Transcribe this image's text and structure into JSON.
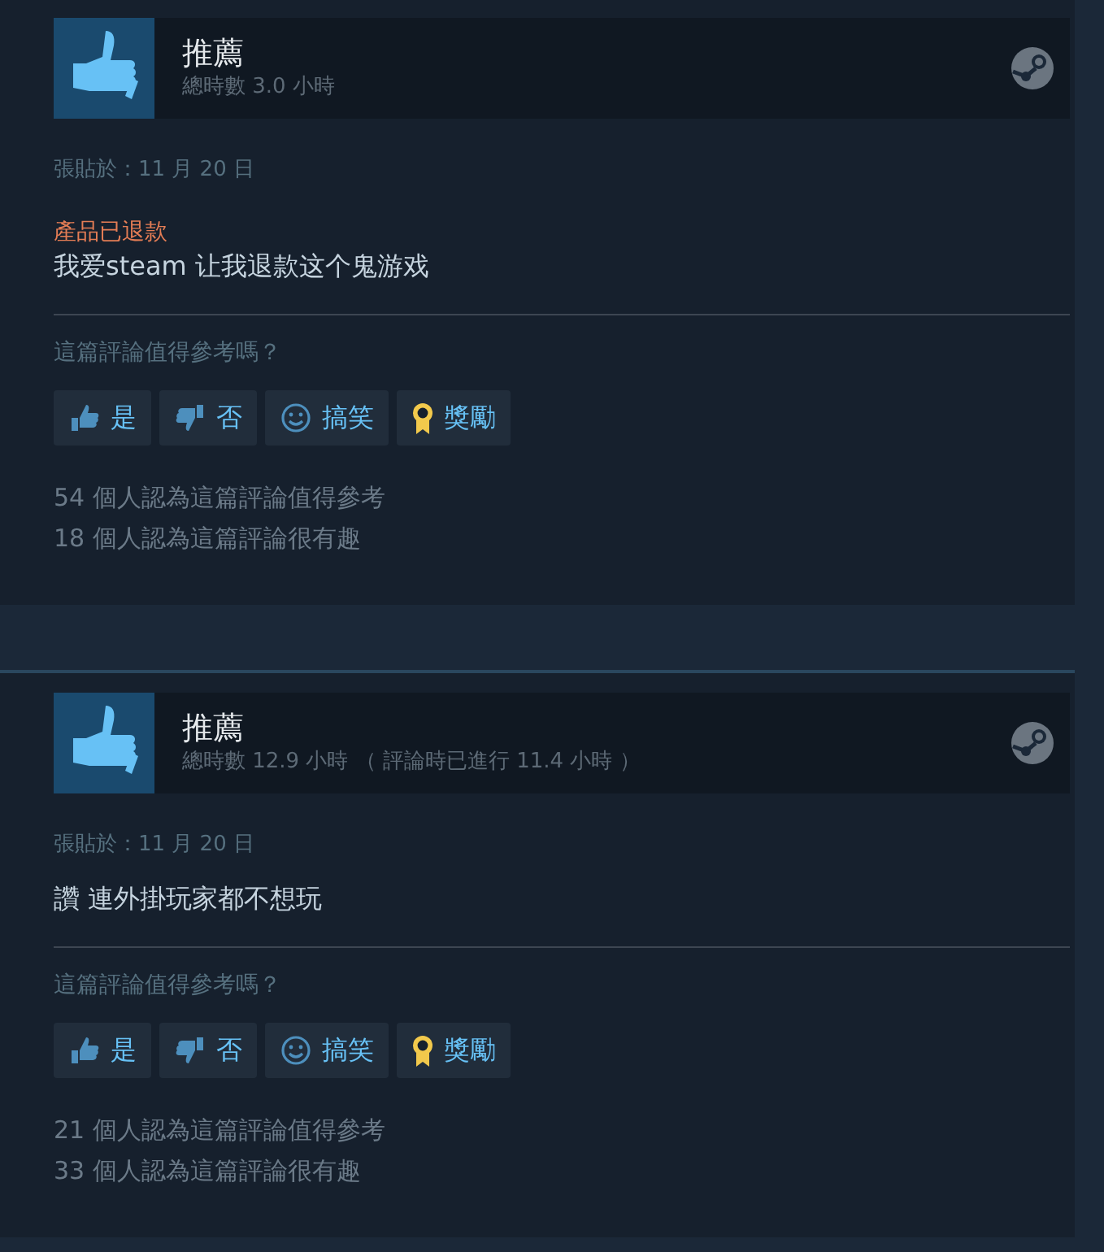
{
  "reviews": [
    {
      "title": "推薦",
      "hours": "總時數 3.0 小時",
      "posted": "張貼於：11 月 20 日",
      "notice": "產品已退款",
      "text": "我爱steam 让我退款这个鬼游戏",
      "question": "這篇評論值得參考嗎？",
      "buttons": [
        {
          "kind": "yes",
          "label": "是"
        },
        {
          "kind": "no",
          "label": "否"
        },
        {
          "kind": "funny",
          "label": "搞笑"
        },
        {
          "kind": "award",
          "label": "獎勵"
        }
      ],
      "stats": [
        "54 個人認為這篇評論值得參考",
        "18 個人認為這篇評論很有趣"
      ]
    },
    {
      "title": "推薦",
      "hours": "總時數 12.9 小時 （ 評論時已進行 11.4 小時 ）",
      "posted": "張貼於：11 月 20 日",
      "text": "讚 連外掛玩家都不想玩",
      "question": "這篇評論值得參考嗎？",
      "buttons": [
        {
          "kind": "yes",
          "label": "是"
        },
        {
          "kind": "no",
          "label": "否"
        },
        {
          "kind": "funny",
          "label": "搞笑"
        },
        {
          "kind": "award",
          "label": "獎勵"
        }
      ],
      "stats": [
        "21 個人認為這篇評論值得參考",
        "33 個人認為這篇評論很有趣"
      ]
    }
  ]
}
